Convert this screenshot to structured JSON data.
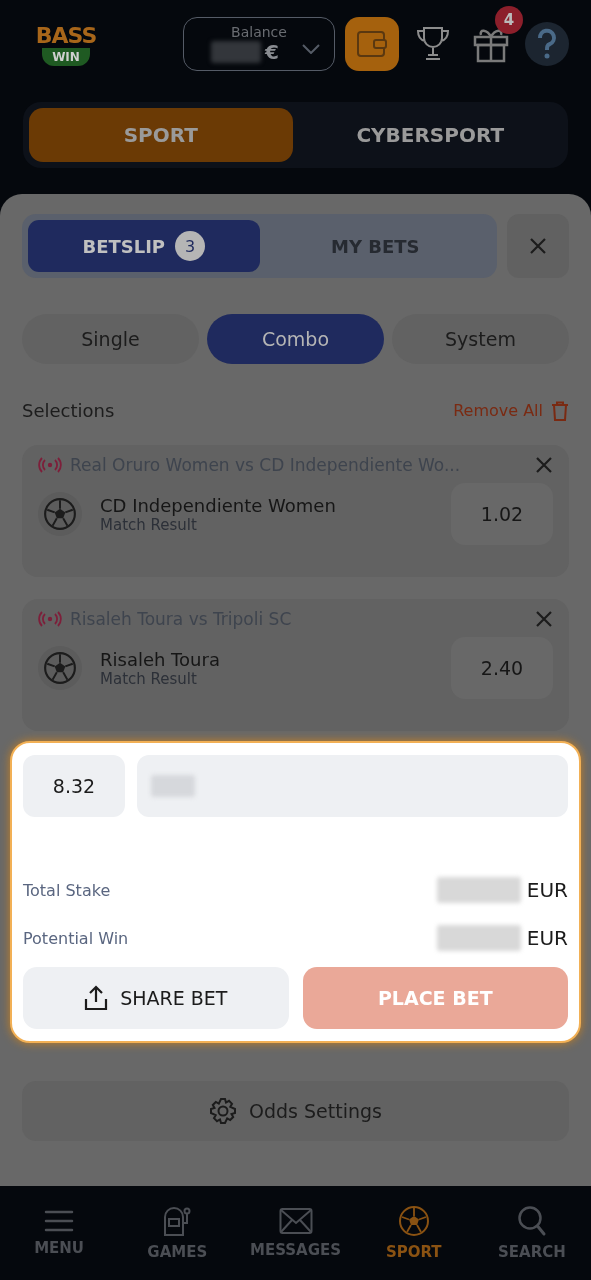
{
  "header": {
    "logo": {
      "line1": "BASS",
      "line2": "WIN"
    },
    "balance": {
      "label": "Balance",
      "currency": "€"
    },
    "gift_badge": "4"
  },
  "section_tabs": [
    {
      "label": "SPORT",
      "selected": true
    },
    {
      "label": "CYBERSPORT",
      "selected": false
    }
  ],
  "betslip_tabs": [
    {
      "label": "BETSLIP",
      "badge": "3",
      "selected": true
    },
    {
      "label": "MY BETS",
      "selected": false
    }
  ],
  "bet_types": [
    {
      "label": "Single",
      "selected": false
    },
    {
      "label": "Combo",
      "selected": true
    },
    {
      "label": "System",
      "selected": false
    }
  ],
  "selections_title": "Selections",
  "remove_all": "Remove All",
  "selections": [
    {
      "event": "Real Oruro Women vs CD Independiente Wo...",
      "live": true,
      "pick": "CD Independiente Women",
      "market": "Match Result",
      "odds": "1.02"
    },
    {
      "event": "Risaleh Toura vs Tripoli SC",
      "live": true,
      "pick": "Risaleh Toura",
      "market": "Match Result",
      "odds": "2.40"
    }
  ],
  "stake_panel": {
    "total_odds": "8.32",
    "rows": [
      {
        "label": "Total Stake",
        "currency": "EUR"
      },
      {
        "label": "Potential Win",
        "currency": "EUR"
      }
    ],
    "share_button": "SHARE BET",
    "place_button": "PLACE BET"
  },
  "odds_settings": "Odds Settings",
  "nav": [
    {
      "kind": "menu",
      "label": "MENU",
      "selected": false
    },
    {
      "kind": "games",
      "label": "GAMES",
      "selected": false
    },
    {
      "kind": "messages",
      "label": "MESSAGES",
      "selected": false
    },
    {
      "kind": "sport",
      "label": "SPORT",
      "selected": true
    },
    {
      "kind": "search",
      "label": "SEARCH",
      "selected": false
    }
  ]
}
